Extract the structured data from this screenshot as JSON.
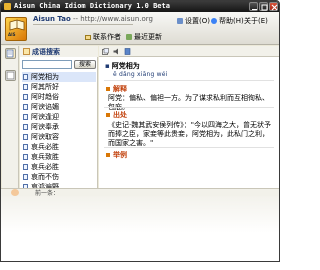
{
  "window": {
    "title": "Aisun China Idiom Dictionary 1.0 Beta"
  },
  "header": {
    "logo_text": "AIS",
    "author_name": "Aisun Tao",
    "author_url": "-- http://www.aisun.org",
    "menu": {
      "settings": "设置(O)",
      "help": "帮助(H)",
      "about": "关于(E)"
    },
    "contact_label": "联系作者",
    "update_label": "最近更新"
  },
  "search": {
    "heading": "成语搜索",
    "input_value": "",
    "button_label": "搜索"
  },
  "idiom_list": [
    "阿党相为",
    "阿其所好",
    "阿时趋俗",
    "阿谀谄媚",
    "阿谀逢迎",
    "阿谀奉承",
    "阿谀取容",
    "哀兵必胜",
    "哀兵致胜",
    "哀兵必胜",
    "哀而不伤",
    "哀鸿遍野"
  ],
  "selected_index": 0,
  "entry": {
    "title": "阿党相为",
    "pinyin": "ē dǎng xiāng wéi",
    "meaning_head": "解释",
    "meaning": "阿党：偏私、偏袒一方。为了谋求私利而互相徇私、包庇。",
    "source_head": "出处",
    "source": "《史记·魏其武安侯列传》：\"今以四海之大，曾无状予而捧之臣，家妾等此贵妾，阿党相为，此私门之利，而国家之害。\"",
    "example_head": "举例"
  },
  "status": {
    "text": "前一条："
  },
  "colors": {
    "titlebar": "#1e1e1e",
    "accent_blue": "#1f3b73",
    "section_orange": "#c2410c",
    "selection": "#dbe6f9"
  }
}
